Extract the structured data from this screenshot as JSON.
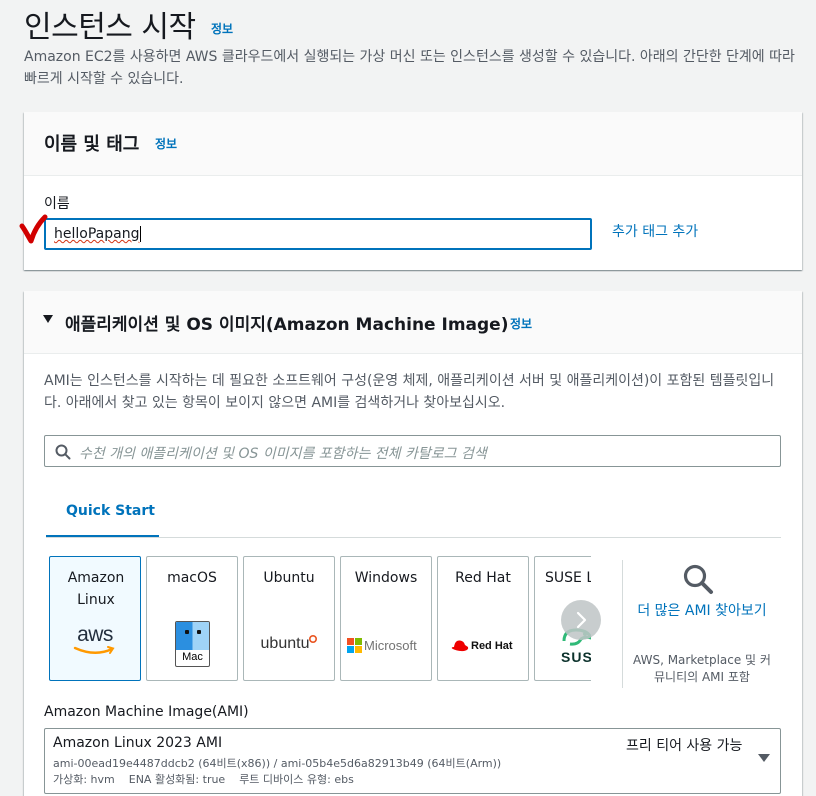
{
  "page": {
    "title": "인스턴스 시작",
    "info": "정보",
    "description": "Amazon EC2를 사용하면 AWS 클라우드에서 실행되는 가상 머신 또는 인스턴스를 생성할 수 있습니다. 아래의 간단한 단계에 따라 빠르게 시작할 수 있습니다."
  },
  "name_tags": {
    "title": "이름 및 태그",
    "info": "정보",
    "name_label": "이름",
    "name_value": "helloPapang",
    "add_tags": "추가 태그 추가"
  },
  "ami": {
    "title": "애플리케이션 및 OS 이미지(Amazon Machine Image)",
    "info": "정보",
    "description": "AMI는 인스턴스를 시작하는 데 필요한 소프트웨어 구성(운영 체제, 애플리케이션 서버 및 애플리케이션)이 포함된 템플릿입니다. 아래에서 찾고 있는 항목이 보이지 않으면 AMI를 검색하거나 찾아보십시오.",
    "search_placeholder": "수천 개의 애플리케이션 및 OS 이미지를 포함하는 전체 카탈로그 검색",
    "tab_quick_start": "Quick Start",
    "tiles": [
      {
        "label": "Amazon Linux",
        "logo": "aws"
      },
      {
        "label": "macOS",
        "logo": "Mac"
      },
      {
        "label": "Ubuntu",
        "logo": "ubuntu"
      },
      {
        "label": "Windows",
        "logo": "Microsoft"
      },
      {
        "label": "Red Hat",
        "logo": "Red Hat"
      },
      {
        "label": "SUSE Li",
        "logo": "SUS"
      }
    ],
    "more_ami": "더 많은 AMI 찾아보기",
    "more_ami_sub": "AWS, Marketplace 및 커뮤니티의 AMI 포함",
    "ami_label": "Amazon Machine Image(AMI)",
    "selected_name": "Amazon Linux 2023 AMI",
    "free_tier": "프리 티어 사용 가능",
    "selected_ids": "ami-00ead19e4487ddcb2 (64비트(x86)) / ami-05b4e5d6a82913b49 (64비트(Arm))",
    "selected_meta": "가상화: hvm    ENA 활성화됨: true    루트 디바이스 유형: ebs"
  },
  "colors": {
    "accent": "#0073bb",
    "annotation_mark": "#d10000"
  }
}
